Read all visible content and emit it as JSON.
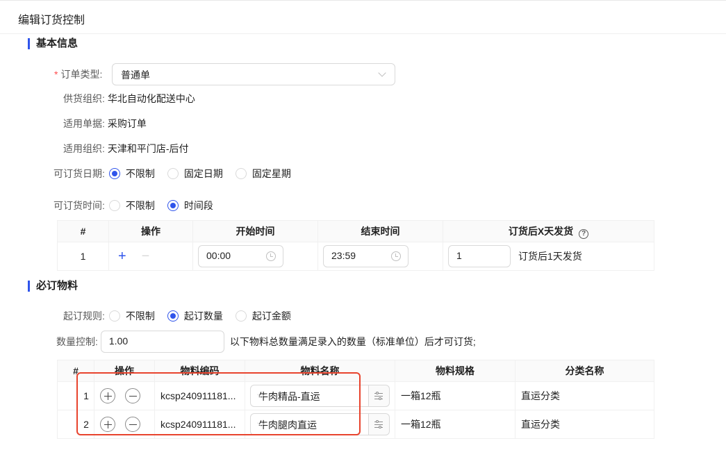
{
  "page": {
    "title": "编辑订货控制"
  },
  "basic": {
    "section_title": "基本信息",
    "order_type": {
      "required_mark": "*",
      "label": "订单类型:",
      "value": "普通单"
    },
    "supply_org": {
      "label": "供货组织:",
      "value": "华北自动化配送中心"
    },
    "applicable_doc": {
      "label": "适用单据:",
      "value": "采购订单"
    },
    "applicable_org": {
      "label": "适用组织:",
      "value": "天津和平门店-后付"
    },
    "order_date": {
      "label": "可订货日期:",
      "options": [
        "不限制",
        "固定日期",
        "固定星期"
      ],
      "selected": 0
    },
    "order_time": {
      "label": "可订货时间:",
      "options": [
        "不限制",
        "时间段"
      ],
      "selected": 1
    }
  },
  "time_table": {
    "headers": [
      "#",
      "操作",
      "开始时间",
      "结束时间",
      "订货后X天发货"
    ],
    "help_icon": "question-circle-icon",
    "rows": [
      {
        "index": "1",
        "add": "+",
        "remove": "−",
        "start": "00:00",
        "end": "23:59",
        "days": "1",
        "note": "订货后1天发货"
      }
    ]
  },
  "required": {
    "section_title": "必订物料",
    "rule": {
      "label": "起订规则:",
      "options": [
        "不限制",
        "起订数量",
        "起订金额"
      ],
      "selected": 1
    },
    "qty": {
      "label": "数量控制:",
      "value": "1.00",
      "hint": "以下物料总数量满足录入的数量（标准单位）后才可订货;"
    }
  },
  "material_table": {
    "headers": [
      "#",
      "操作",
      "物料编码",
      "物料名称",
      "物料规格",
      "分类名称"
    ],
    "rows": [
      {
        "index": "1",
        "code": "kcsp240911181...",
        "name": "牛肉精品-直运",
        "spec": "一箱12瓶",
        "category": "直运分类"
      },
      {
        "index": "2",
        "code": "kcsp240911181...",
        "name": "牛肉腿肉直运",
        "spec": "一箱12瓶",
        "category": "直运分类"
      }
    ]
  },
  "colors": {
    "accent": "#2f54eb",
    "required": "#ff4d4f",
    "highlight": "#e8432d"
  }
}
